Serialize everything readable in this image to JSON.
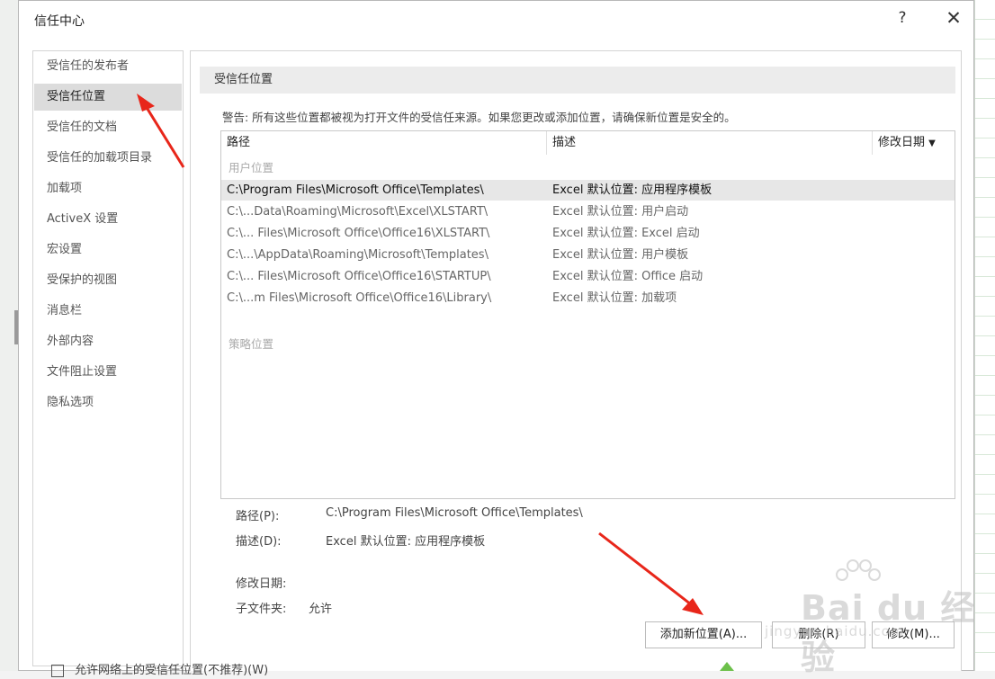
{
  "window": {
    "title": "信任中心",
    "help_label": "?",
    "close_label": "✕"
  },
  "sidebar": {
    "items": [
      {
        "label": "受信任的发布者"
      },
      {
        "label": "受信任位置"
      },
      {
        "label": "受信任的文档"
      },
      {
        "label": "受信任的加载项目录"
      },
      {
        "label": "加载项"
      },
      {
        "label": "ActiveX 设置"
      },
      {
        "label": "宏设置"
      },
      {
        "label": "受保护的视图"
      },
      {
        "label": "消息栏"
      },
      {
        "label": "外部内容"
      },
      {
        "label": "文件阻止设置"
      },
      {
        "label": "隐私选项"
      }
    ],
    "active_index": 1
  },
  "main": {
    "section_title": "受信任位置",
    "warning": "警告: 所有这些位置都被视为打开文件的受信任来源。如果您更改或添加位置，请确保新位置是安全的。",
    "table": {
      "headers": [
        "路径",
        "描述",
        "修改日期"
      ],
      "sort_indicator": "▼",
      "user_group_label": "用户位置",
      "policy_group_label": "策略位置",
      "rows": [
        {
          "path": "C:\\Program Files\\Microsoft Office\\Templates\\",
          "description": "Excel 默认位置: 应用程序模板",
          "date": ""
        },
        {
          "path": "C:\\...Data\\Roaming\\Microsoft\\Excel\\XLSTART\\",
          "description": "Excel 默认位置: 用户启动",
          "date": ""
        },
        {
          "path": "C:\\... Files\\Microsoft Office\\Office16\\XLSTART\\",
          "description": "Excel 默认位置: Excel 启动",
          "date": ""
        },
        {
          "path": "C:\\...\\AppData\\Roaming\\Microsoft\\Templates\\",
          "description": "Excel 默认位置: 用户模板",
          "date": ""
        },
        {
          "path": "C:\\... Files\\Microsoft Office\\Office16\\STARTUP\\",
          "description": "Excel 默认位置: Office 启动",
          "date": ""
        },
        {
          "path": "C:\\...m Files\\Microsoft Office\\Office16\\Library\\",
          "description": "Excel 默认位置: 加载项",
          "date": ""
        }
      ]
    },
    "details": {
      "path_label": "路径(P):",
      "path_value": "C:\\Program Files\\Microsoft Office\\Templates\\",
      "desc_label": "描述(D):",
      "desc_value": "Excel 默认位置: 应用程序模板",
      "date_label": "修改日期:",
      "date_value": "",
      "subfolders_label": "子文件夹:",
      "subfolders_value": "允许"
    },
    "buttons": {
      "add": "添加新位置(A)...",
      "remove": "删除(R)",
      "modify": "修改(M)..."
    },
    "checkbox_label": "允许网络上的受信任位置(不推荐)(W)"
  },
  "watermark": {
    "brand": "Bai du 经验",
    "sub": "jingyan.baidu.com"
  },
  "colors": {
    "arrow": "#e8261a",
    "selected_row": "#e7e7e7",
    "active_nav": "#dcdcdc"
  }
}
